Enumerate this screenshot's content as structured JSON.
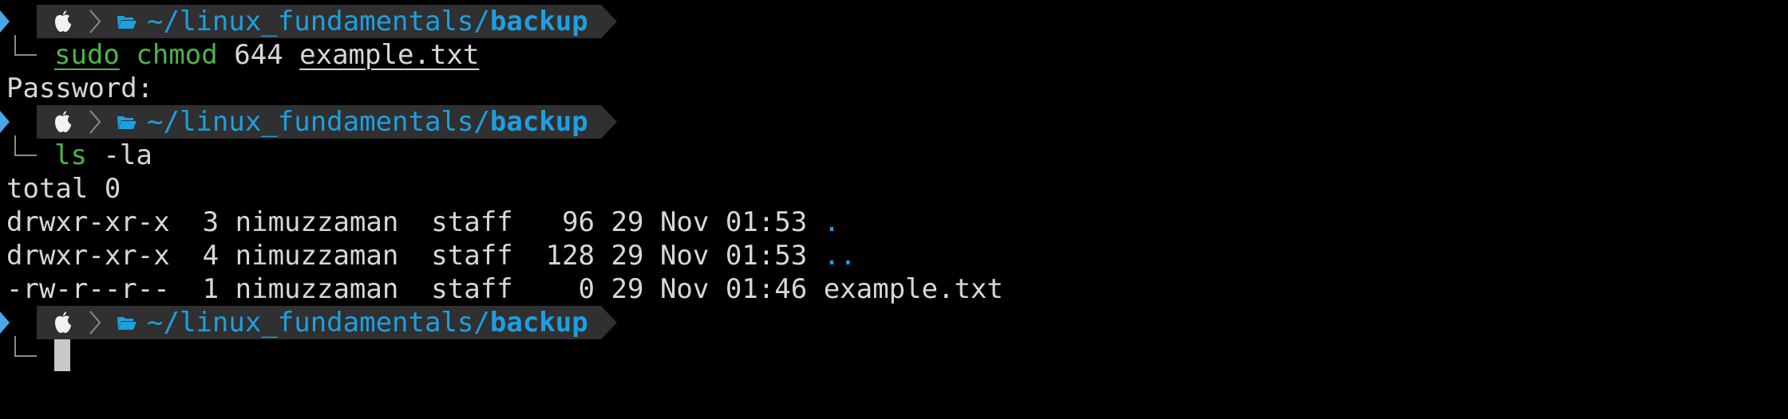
{
  "colors": {
    "background": "#000000",
    "text": "#d7d7d7",
    "prompt_bar": "#303030",
    "path": "#1e9fe0",
    "command": "#4fb34a",
    "chevron": "#4aa6e6"
  },
  "prompts": [
    {
      "path_prefix": "~/linux_fundamentals/",
      "path_dir": "backup"
    },
    {
      "path_prefix": "~/linux_fundamentals/",
      "path_dir": "backup"
    },
    {
      "path_prefix": "~/linux_fundamentals/",
      "path_dir": "backup"
    }
  ],
  "commands": [
    {
      "cmd": "sudo",
      "arg1": "chmod",
      "arg2": "644",
      "arg3": "example.txt"
    },
    {
      "cmd": "ls",
      "arg1": "-la"
    }
  ],
  "password_prompt": "Password:",
  "listing": {
    "total": "total 0",
    "rows": [
      {
        "perms": "drwxr-xr-x",
        "links": "3",
        "owner": "nimuzzaman",
        "group": "staff",
        "size": "96",
        "day": "29",
        "month": "Nov",
        "time": "01:53",
        "name": "."
      },
      {
        "perms": "drwxr-xr-x",
        "links": "4",
        "owner": "nimuzzaman",
        "group": "staff",
        "size": "128",
        "day": "29",
        "month": "Nov",
        "time": "01:53",
        "name": ".."
      },
      {
        "perms": "-rw-r--r--",
        "links": "1",
        "owner": "nimuzzaman",
        "group": "staff",
        "size": "0",
        "day": "29",
        "month": "Nov",
        "time": "01:46",
        "name": "example.txt"
      }
    ]
  },
  "icons": {
    "os": "apple-icon",
    "separator": "chevron-right-icon",
    "directory": "folder-open-icon"
  }
}
